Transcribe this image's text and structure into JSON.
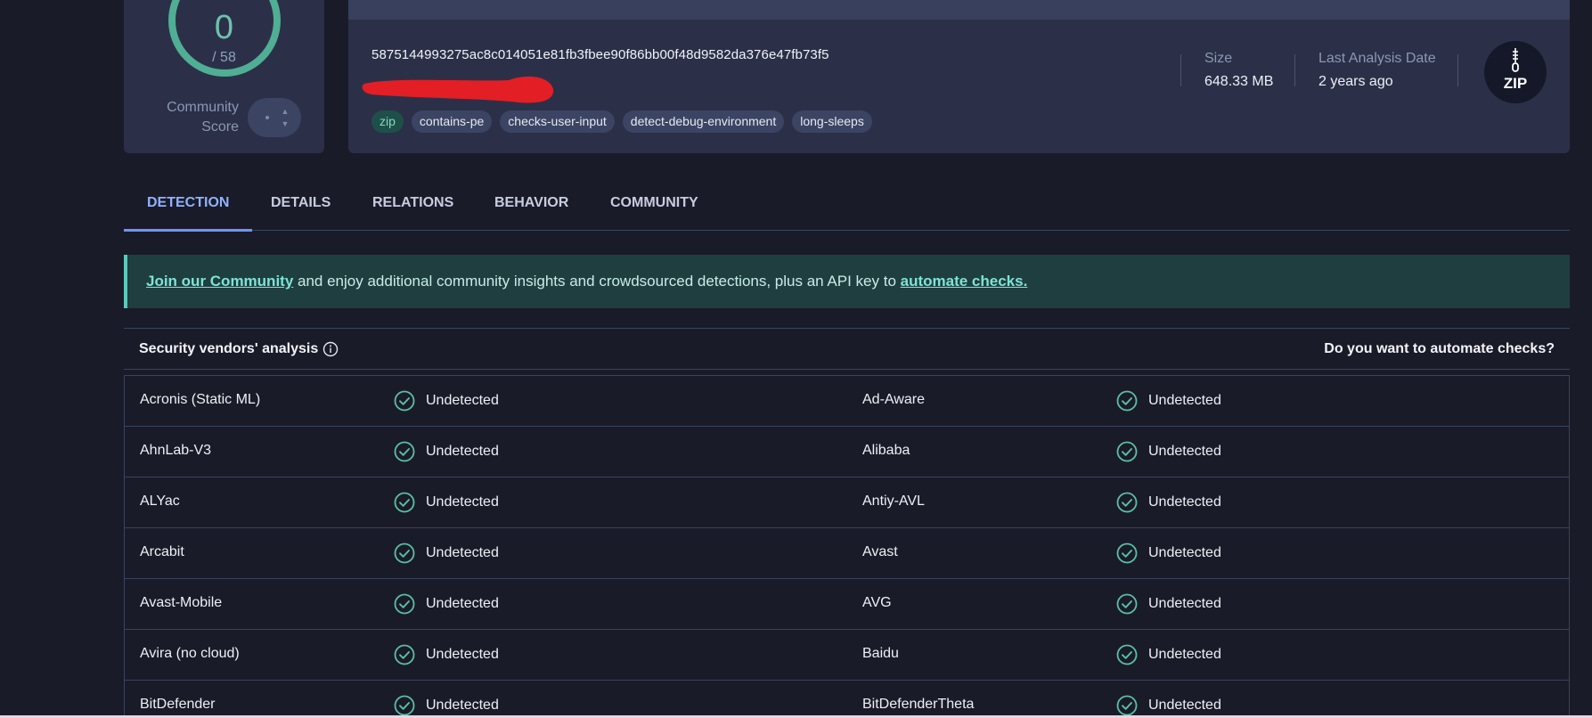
{
  "score": {
    "detections": "0",
    "total": "/ 58",
    "community_label": "Community Score"
  },
  "file": {
    "hash": "5875144993275ac8c014051e81fb3fbee90f86bb00f48d9582da376e47fb73f5",
    "tags": [
      "zip",
      "contains-pe",
      "checks-user-input",
      "detect-debug-environment",
      "long-sleeps"
    ],
    "size_label": "Size",
    "size_value": "648.33 MB",
    "date_label": "Last Analysis Date",
    "date_value": "2 years ago",
    "type_icon": "ZIP"
  },
  "tabs": [
    {
      "label": "DETECTION",
      "active": true
    },
    {
      "label": "DETAILS",
      "active": false
    },
    {
      "label": "RELATIONS",
      "active": false
    },
    {
      "label": "BEHAVIOR",
      "active": false
    },
    {
      "label": "COMMUNITY",
      "active": false
    }
  ],
  "banner": {
    "link1": "Join our Community",
    "middle": " and enjoy additional community insights and crowdsourced detections, plus an API key to ",
    "link2": "automate checks."
  },
  "vendors": {
    "title": "Security vendors' analysis",
    "automate": "Do you want to automate checks?",
    "rows": [
      {
        "left": "Acronis (Static ML)",
        "left_status": "Undetected",
        "right": "Ad-Aware",
        "right_status": "Undetected"
      },
      {
        "left": "AhnLab-V3",
        "left_status": "Undetected",
        "right": "Alibaba",
        "right_status": "Undetected"
      },
      {
        "left": "ALYac",
        "left_status": "Undetected",
        "right": "Antiy-AVL",
        "right_status": "Undetected"
      },
      {
        "left": "Arcabit",
        "left_status": "Undetected",
        "right": "Avast",
        "right_status": "Undetected"
      },
      {
        "left": "Avast-Mobile",
        "left_status": "Undetected",
        "right": "AVG",
        "right_status": "Undetected"
      },
      {
        "left": "Avira (no cloud)",
        "left_status": "Undetected",
        "right": "Baidu",
        "right_status": "Undetected"
      },
      {
        "left": "BitDefender",
        "left_status": "Undetected",
        "right": "BitDefenderTheta",
        "right_status": "Undetected"
      }
    ]
  },
  "colors": {
    "background": "#1a1b28",
    "card": "#2b3048",
    "accent_green": "#4fae94",
    "tab_active": "#8fb2ff",
    "banner_bg": "#1f3e3f"
  }
}
